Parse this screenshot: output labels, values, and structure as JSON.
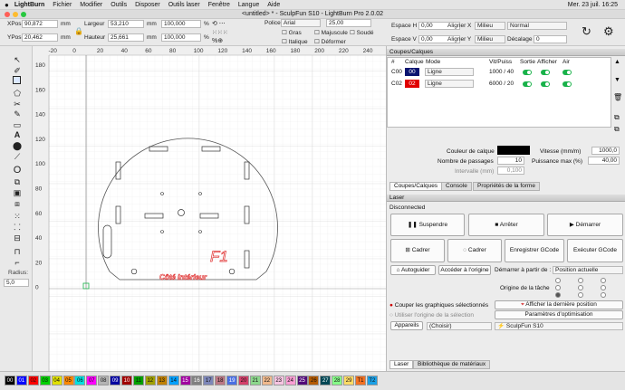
{
  "macmenu": {
    "apple": "",
    "app": "LightBurn",
    "items": [
      "Fichier",
      "Modifier",
      "Outils",
      "Disposer",
      "Outils laser",
      "Fenêtre",
      "Langue",
      "Aide"
    ],
    "datetime": "Mer. 23 juil.  16:25"
  },
  "window": {
    "title": "<untitled> * - SculpFun S10 - LightBurn Pro 2.0.02"
  },
  "toolbar": {
    "xpos_label": "XPos",
    "xpos": "90,872",
    "ypos_label": "YPos",
    "ypos": "20,462",
    "unit": "mm",
    "width_label": "Largeur",
    "width": "53,210",
    "height_label": "Hauteur",
    "height": "25,661",
    "scale_w": "100,000",
    "scale_h": "100,000",
    "pct": "%",
    "font_label": "Police",
    "font": "Arial",
    "font_height": "25,00",
    "bold": "Gras",
    "italic": "Italique",
    "upper": "Majuscule",
    "weld": "Soudé",
    "distort": "Déformer",
    "hspace_label": "Espace H",
    "hspace": "0,00",
    "vspace_label": "Espace V",
    "vspace": "0,00",
    "align_x_label": "Aligner X",
    "align_x": "Milieu",
    "align_y_label": "Aligner Y",
    "align_y": "Milieu",
    "style": "Normal",
    "offset_label": "Décalage",
    "offset": "0"
  },
  "left_tools": {
    "radius_label": "Radius:",
    "radius": "5,0"
  },
  "canvas": {
    "x_ticks": [
      "-20",
      "0",
      "20",
      "40",
      "60",
      "80",
      "100",
      "120",
      "140",
      "160",
      "180",
      "200",
      "220",
      "240"
    ],
    "y_ticks": [
      "180",
      "160",
      "140",
      "120",
      "100",
      "80",
      "60",
      "40",
      "20",
      "0"
    ],
    "shape_label_1": "F1",
    "shape_label_2": "Côté intérieur"
  },
  "cuts": {
    "header": "Coupes/Calques",
    "columns": [
      "#",
      "Calque",
      "Mode",
      "Vit/Puiss",
      "Sortie",
      "Afficher",
      "Air"
    ],
    "rows": [
      {
        "num": "C00",
        "layer": "00",
        "layer_color": "#0000a0",
        "mode": "Ligne",
        "speed": "1000 / 40"
      },
      {
        "num": "C02",
        "layer": "02",
        "layer_color": "#e00000",
        "mode": "Ligne",
        "speed": "6000 / 20"
      }
    ],
    "layer_color_label": "Couleur de calque",
    "speed_label": "Vitesse (mm/m)",
    "speed": "1000,0",
    "passes_label": "Nombre de passages",
    "passes": "10",
    "power_label": "Puissance max (%)",
    "power": "40,00",
    "interval_label": "Intervalle (mm)",
    "interval": "0,100",
    "tabs": [
      "Coupes/Calques",
      "Console",
      "Propriétés de la forme"
    ]
  },
  "laser": {
    "header": "Laser",
    "status": "Disconnected",
    "pause": "Suspendre",
    "stop": "Arrêter",
    "start": "Démarrer",
    "frame1": "Cadrer",
    "frame2": "Cadrer",
    "save_gcode": "Enregistrer GCode",
    "run_gcode": "Exécuter GCode",
    "home": "Autoguider",
    "goto_origin": "Accéder à l'origine",
    "start_from_label": "Démarrer à partir de :",
    "start_from": "Position actuelle",
    "job_origin_label": "Origine de la tâche",
    "cut_selected": "Couper les graphiques sélectionnés",
    "show_last": "Afficher la dernière position",
    "use_origin": "Utiliser l'origine de la sélection",
    "opt_settings": "Paramètres d'optimisation",
    "devices": "Appareils",
    "choice": "(Choisir)",
    "device": "SculpFun S10",
    "bottom_tabs": [
      "Laser",
      "Bibliothèque de matériaux"
    ]
  },
  "palette": [
    {
      "label": "00",
      "color": "#000000"
    },
    {
      "label": "01",
      "color": "#0000ff"
    },
    {
      "label": "02",
      "color": "#ff0000"
    },
    {
      "label": "03",
      "color": "#00d000"
    },
    {
      "label": "04",
      "color": "#e0e000"
    },
    {
      "label": "05",
      "color": "#ff8800"
    },
    {
      "label": "06",
      "color": "#00e0e0"
    },
    {
      "label": "07",
      "color": "#ff00ff"
    },
    {
      "label": "08",
      "color": "#b4b4b4"
    },
    {
      "label": "09",
      "color": "#0000a0"
    },
    {
      "label": "10",
      "color": "#a00000"
    },
    {
      "label": "11",
      "color": "#00a000"
    },
    {
      "label": "12",
      "color": "#a0a000"
    },
    {
      "label": "13",
      "color": "#c08000"
    },
    {
      "label": "14",
      "color": "#00a0ff"
    },
    {
      "label": "15",
      "color": "#a000a0"
    },
    {
      "label": "16",
      "color": "#808080"
    },
    {
      "label": "17",
      "color": "#7d87b9"
    },
    {
      "label": "18",
      "color": "#bb7784"
    },
    {
      "label": "19",
      "color": "#4a6fe3"
    },
    {
      "label": "20",
      "color": "#d33f6a"
    },
    {
      "label": "21",
      "color": "#8cd78c"
    },
    {
      "label": "22",
      "color": "#f0b98d"
    },
    {
      "label": "23",
      "color": "#f6c4e1"
    },
    {
      "label": "24",
      "color": "#fa9ed4"
    },
    {
      "label": "25",
      "color": "#500a78"
    },
    {
      "label": "26",
      "color": "#b45a00"
    },
    {
      "label": "27",
      "color": "#004754"
    },
    {
      "label": "28",
      "color": "#86fa88"
    },
    {
      "label": "29",
      "color": "#ffdb66"
    },
    {
      "label": "T1",
      "color": "#f37021"
    },
    {
      "label": "T2",
      "color": "#1aa0e6"
    }
  ]
}
